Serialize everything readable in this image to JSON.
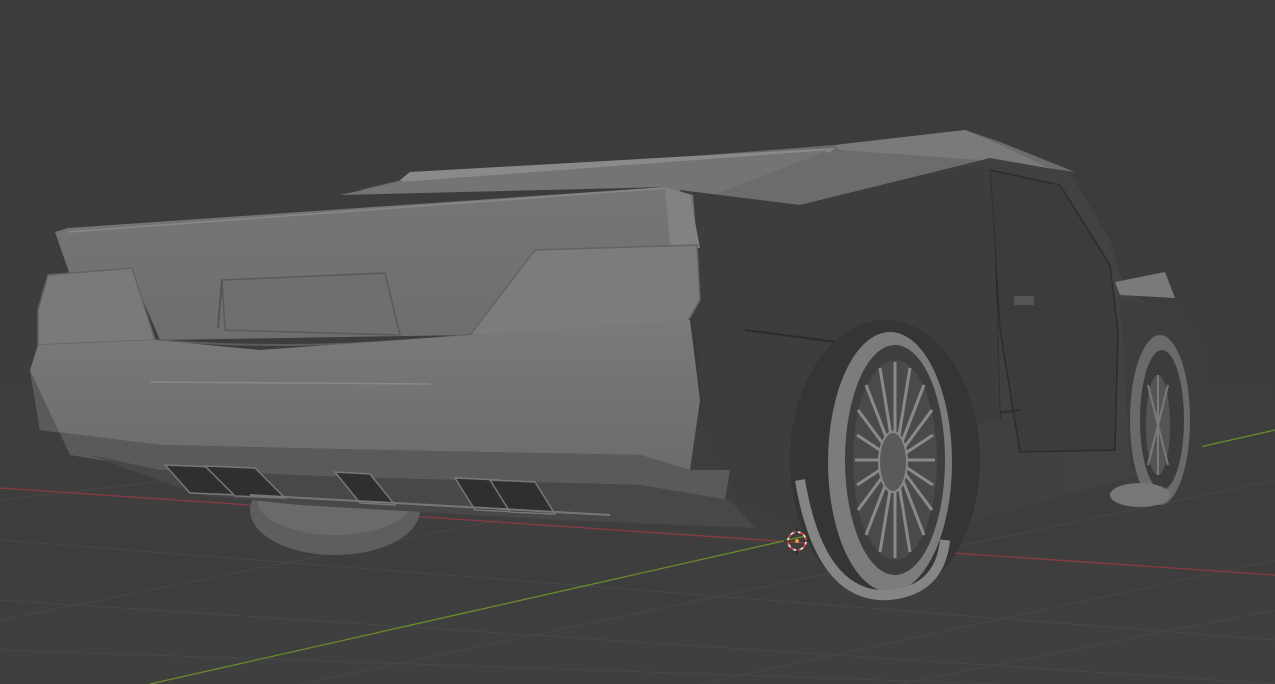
{
  "viewport": {
    "type": "3d-viewport",
    "background_color": "#3d3d3d",
    "shading": "solid",
    "object": "car-model",
    "axes": {
      "x_axis_color": "#8a3a44",
      "y_axis_color": "#6a8a2a"
    },
    "grid_color": "#4a4a4a",
    "origin_cursor": "3d-cursor"
  }
}
